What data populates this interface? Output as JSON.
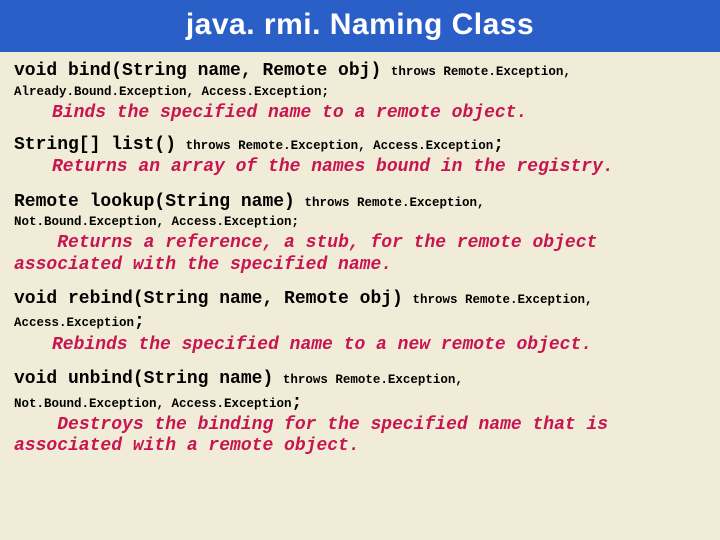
{
  "title": "java. rmi. Naming Class",
  "methods": {
    "bind": {
      "sig": "void bind(String name, Remote obj)",
      "throws1": " throws Remote.Exception,",
      "throws2": "Already.Bound.Exception, Access.Exception;",
      "desc": "Binds the specified name to a remote object."
    },
    "list": {
      "sig": "String[] list()",
      "throws1": " throws Remote.Exception, Access.Exception",
      "desc": "Returns an array of the names bound in the registry."
    },
    "lookup": {
      "sig": "Remote lookup(String name)",
      "throws1": " throws Remote.Exception,",
      "throws2": "Not.Bound.Exception, Access.Exception;",
      "desc": "Returns a reference, a stub, for the remote object associated with the specified name."
    },
    "rebind": {
      "sig": "void rebind(String name, Remote obj)",
      "throws1": " throws Remote.Exception,",
      "throws2": "Access.Exception",
      "desc": "Rebinds the specified name to a new remote object."
    },
    "unbind": {
      "sig": "void unbind(String name)",
      "throws1": " throws Remote.Exception,",
      "throws2": "Not.Bound.Exception, Access.Exception",
      "desc": "Destroys the binding for the specified name that is associated with a remote object."
    }
  }
}
